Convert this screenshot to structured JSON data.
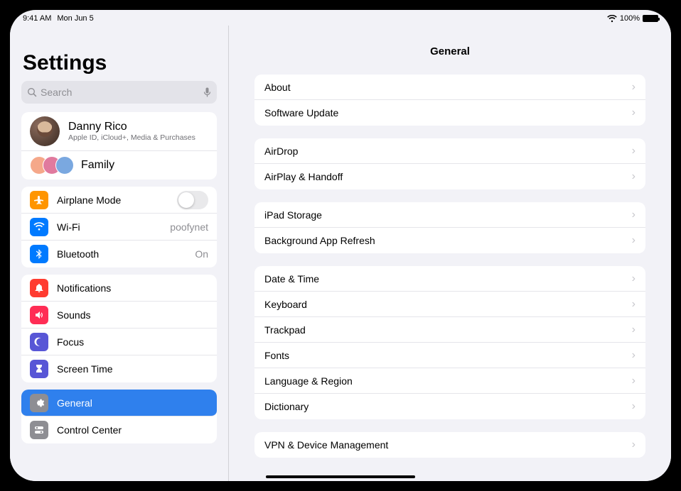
{
  "status": {
    "time": "9:41 AM",
    "date": "Mon Jun 5",
    "battery_percent": "100%"
  },
  "sidebar": {
    "title": "Settings",
    "search_placeholder": "Search",
    "account": {
      "name": "Danny Rico",
      "subtitle": "Apple ID, iCloud+, Media & Purchases"
    },
    "family_label": "Family",
    "groups": [
      {
        "id": "connectivity",
        "items": [
          {
            "id": "airplane",
            "label": "Airplane Mode",
            "icon_bg": "#ff9500",
            "glyph": "airplane",
            "control": "toggle",
            "toggle_on": false
          },
          {
            "id": "wifi",
            "label": "Wi-Fi",
            "icon_bg": "#007aff",
            "glyph": "wifi",
            "value": "poofynet",
            "chevron": true
          },
          {
            "id": "bluetooth",
            "label": "Bluetooth",
            "icon_bg": "#007aff",
            "glyph": "bluetooth",
            "value": "On",
            "chevron": true
          }
        ]
      },
      {
        "id": "alerts",
        "items": [
          {
            "id": "notifications",
            "label": "Notifications",
            "icon_bg": "#ff3b30",
            "glyph": "bell",
            "chevron": true
          },
          {
            "id": "sounds",
            "label": "Sounds",
            "icon_bg": "#ff2d55",
            "glyph": "speaker",
            "chevron": true
          },
          {
            "id": "focus",
            "label": "Focus",
            "icon_bg": "#5856d6",
            "glyph": "moon",
            "chevron": true
          },
          {
            "id": "screentime",
            "label": "Screen Time",
            "icon_bg": "#5856d6",
            "glyph": "hourglass",
            "chevron": true
          }
        ]
      },
      {
        "id": "system",
        "items": [
          {
            "id": "general",
            "label": "General",
            "icon_bg": "#8e8e93",
            "glyph": "gear",
            "selected": true
          },
          {
            "id": "controlcenter",
            "label": "Control Center",
            "icon_bg": "#8e8e93",
            "glyph": "switches",
            "chevron": true
          }
        ]
      }
    ]
  },
  "detail": {
    "title": "General",
    "sections": [
      {
        "rows": [
          {
            "label": "About"
          },
          {
            "label": "Software Update"
          }
        ]
      },
      {
        "rows": [
          {
            "label": "AirDrop"
          },
          {
            "label": "AirPlay & Handoff"
          }
        ]
      },
      {
        "rows": [
          {
            "label": "iPad Storage"
          },
          {
            "label": "Background App Refresh"
          }
        ]
      },
      {
        "rows": [
          {
            "label": "Date & Time"
          },
          {
            "label": "Keyboard"
          },
          {
            "label": "Trackpad"
          },
          {
            "label": "Fonts"
          },
          {
            "label": "Language & Region"
          },
          {
            "label": "Dictionary"
          }
        ]
      },
      {
        "rows": [
          {
            "label": "VPN & Device Management"
          }
        ]
      }
    ]
  }
}
